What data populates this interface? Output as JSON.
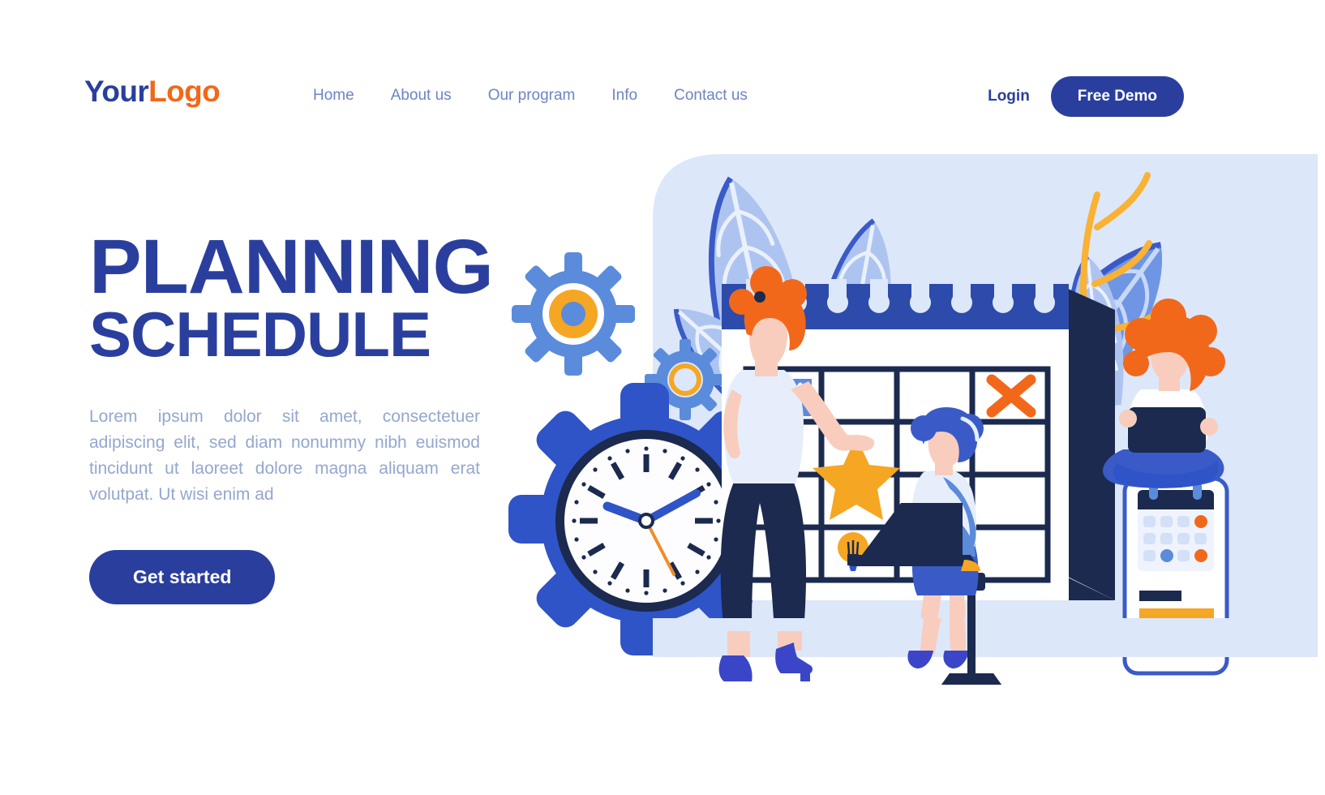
{
  "brand": {
    "logo_part1": "Your",
    "logo_part2": "Logo",
    "color_primary": "#2a3f9d",
    "color_accent": "#f2681a"
  },
  "header": {
    "nav": [
      {
        "label": "Home"
      },
      {
        "label": "About us"
      },
      {
        "label": "Our program"
      },
      {
        "label": "Info"
      },
      {
        "label": "Contact us"
      }
    ],
    "login_label": "Login",
    "demo_label": "Free Demo"
  },
  "hero": {
    "title_line1": "PLANNING",
    "title_line2": "SCHEDULE",
    "paragraph": "Lorem ipsum dolor sit amet, consectetuer adipiscing elit, sed diam nonummy nibh euismod tincidunt ut laoreet dolore magna aliquam erat volutpat. Ut wisi enim ad",
    "cta_label": "Get started"
  },
  "illustration": {
    "scene_name": "planning-schedule-scene",
    "panel_color": "#dde7fa",
    "items": [
      {
        "name": "clock-gear",
        "label": "clock"
      },
      {
        "name": "gear-large",
        "label": "gear"
      },
      {
        "name": "gear-small",
        "label": "gear"
      },
      {
        "name": "wall-calendar",
        "label": "calendar"
      },
      {
        "name": "chart-icon",
        "label": "chart"
      },
      {
        "name": "cross-mark-icon",
        "label": "cross"
      },
      {
        "name": "star-icon",
        "label": "star"
      },
      {
        "name": "lightbulb-icon",
        "label": "idea"
      },
      {
        "name": "woman-standing",
        "label": "person"
      },
      {
        "name": "woman-with-laptop",
        "label": "person"
      },
      {
        "name": "person-on-phone",
        "label": "person"
      },
      {
        "name": "phone-calendar-app",
        "label": "phone"
      },
      {
        "name": "plant-leaves",
        "label": "leaves"
      }
    ]
  }
}
